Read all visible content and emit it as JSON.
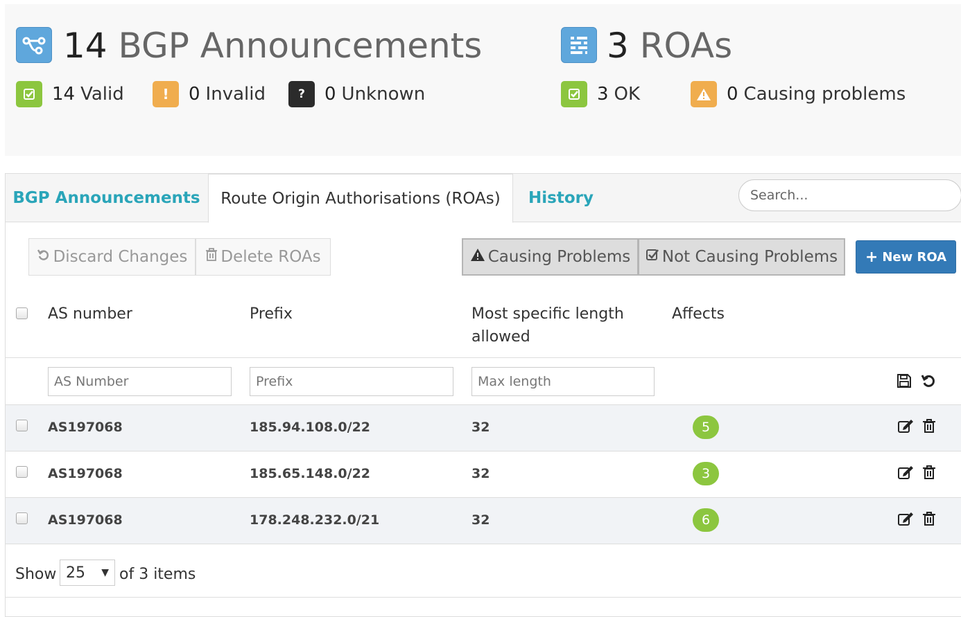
{
  "summary": {
    "bgp": {
      "count": "14",
      "label": "BGP Announcements",
      "icon": "route-icon",
      "statuses": [
        {
          "value": "14",
          "label": "Valid",
          "icon": "check-square-icon",
          "color": "#8cc63f"
        },
        {
          "value": "0",
          "label": "Invalid",
          "icon": "exclamation-icon",
          "color": "#f0ad4e"
        },
        {
          "value": "0",
          "label": "Unknown",
          "icon": "question-icon",
          "color": "#2b2b2b"
        }
      ]
    },
    "roas": {
      "count": "3",
      "label": "ROAs",
      "icon": "list-sliders-icon",
      "statuses": [
        {
          "value": "3",
          "label": "OK",
          "icon": "check-square-icon",
          "color": "#8cc63f"
        },
        {
          "value": "0",
          "label": "Causing problems",
          "icon": "warning-icon",
          "color": "#f0ad4e"
        }
      ]
    }
  },
  "tabs": {
    "items": [
      {
        "label": "BGP Announcements"
      },
      {
        "label": "Route Origin Authorisations (ROAs)"
      },
      {
        "label": "History"
      }
    ],
    "active": "Route Origin Authorisations (ROAs)",
    "search_placeholder": "Search..."
  },
  "toolbar": {
    "discard_label": "Discard Changes",
    "delete_label": "Delete ROAs",
    "causing_label": "Causing Problems",
    "not_causing_label": "Not Causing Problems",
    "new_roa_label": "New ROA"
  },
  "table": {
    "headers": {
      "as_number": "AS number",
      "prefix": "Prefix",
      "max_length_line1": "Most specific length",
      "max_length_line2": "allowed",
      "affects": "Affects"
    },
    "filters": {
      "as_number_placeholder": "AS Number",
      "prefix_placeholder": "Prefix",
      "max_length_placeholder": "Max length"
    },
    "rows": [
      {
        "as_number": "AS197068",
        "prefix": "185.94.108.0/22",
        "max_length": "32",
        "affects": "5"
      },
      {
        "as_number": "AS197068",
        "prefix": "185.65.148.0/22",
        "max_length": "32",
        "affects": "3"
      },
      {
        "as_number": "AS197068",
        "prefix": "178.248.232.0/21",
        "max_length": "32",
        "affects": "6"
      }
    ]
  },
  "pager": {
    "show_label": "Show",
    "page_size": "25",
    "suffix": "of 3 items"
  },
  "colors": {
    "accent": "#2aa5b9",
    "primary": "#337ab7",
    "success": "#8cc63f",
    "warning": "#f0ad4e"
  }
}
